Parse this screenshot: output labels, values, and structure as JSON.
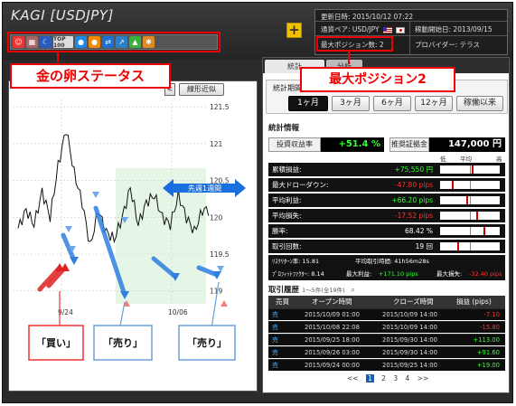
{
  "app": {
    "title": "KAGI [USDJPY]"
  },
  "status_icons": [
    "smile-egg-icon",
    "chart-egg-icon",
    "moon-egg-icon",
    "top100-badge",
    "blue-circle-egg-icon",
    "orange-ball-egg-icon",
    "arrows-egg-icon",
    "trend-egg-icon",
    "tree-egg-icon",
    "gear-egg-icon"
  ],
  "status_top_label": "TOP 100",
  "plus_label": "+",
  "info": {
    "updated_label": "更新日時:",
    "updated_value": "2015/10/12 07:22",
    "pair_label": "通貨ペア:",
    "pair_value": "USD/JPY",
    "start_label": "稼動開始日:",
    "start_value": "2013/09/15",
    "maxpos_label": "最大ポジション数:",
    "maxpos_value": "2",
    "provider_label": "プロバイダー:",
    "provider_value": "テラス"
  },
  "callouts": {
    "status": "金の卵ステータス",
    "maxpos": "最大ポジション2",
    "buy": "「買い」",
    "sell1": "「売り」",
    "sell2": "「売り」"
  },
  "chart": {
    "fit_button": "線形近似",
    "nav_prev": "<",
    "prev_week_label": "先週1週間",
    "y_ticks": [
      "121.5",
      "121",
      "120.5",
      "120",
      "119.5",
      "119"
    ],
    "x_ticks": [
      "9/24",
      "10/06"
    ]
  },
  "chart_data": {
    "type": "line",
    "x": [
      "9/24",
      "10/06"
    ],
    "ylim": [
      118.8,
      121.6
    ],
    "title": "",
    "xlabel": "",
    "ylabel": "",
    "series": [
      {
        "values": [
          119.85,
          120.1,
          119.9,
          120.35,
          120.0,
          120.7,
          121.2,
          120.6,
          120.2,
          119.6,
          120.1,
          119.8,
          119.7,
          120.0,
          120.4,
          119.9,
          120.2,
          120.3,
          120.0,
          119.9,
          120.3,
          120.0,
          119.8,
          120.1
        ]
      }
    ]
  },
  "tabs": [
    "統計",
    "分析"
  ],
  "period": {
    "label": "統計期間",
    "buttons": [
      "1ヶ月",
      "3ヶ月",
      "6ヶ月",
      "12ヶ月",
      "稼働以来"
    ],
    "active": 0
  },
  "stats": {
    "section_title": "統計情報",
    "kpi_return_label": "投資収益率",
    "kpi_return_value": "+51.4 %",
    "kpi_capital_label": "推奨証拠金",
    "kpi_capital_value": "147,000 円",
    "scale_low": "低",
    "scale_mid": "平均",
    "scale_high": "高",
    "rows": [
      {
        "label": "累積損益:",
        "value": "+75,550 円",
        "sign": "pos",
        "level": 0.55
      },
      {
        "label": "最大ドローダウン:",
        "value": "-47.80 pips",
        "sign": "neg",
        "level": 0.2
      },
      {
        "label": "平均利益:",
        "value": "+66.20 pips",
        "sign": "pos",
        "level": 0.45
      },
      {
        "label": "平均損失:",
        "value": "-17.52 pips",
        "sign": "neg",
        "level": 0.62
      },
      {
        "label": "勝率:",
        "value": "68.42 %",
        "sign": "plain",
        "level": 0.75
      },
      {
        "label": "取引回数:",
        "value": "19 回",
        "sign": "plain",
        "level": 0.3
      }
    ],
    "risk_label": "ﾘｽｸﾘﾀｰﾝ率: 15.81",
    "avg_hold_label": "平均取引時間: 41h56m28s",
    "pf_label": "ﾌﾟﾛﾌｨｯﾄﾌｧｸﾀｰ: 8.14",
    "max_profit_label": "最大利益:",
    "max_profit_value": "+171.10 pips",
    "max_loss_label": "最大損失:",
    "max_loss_value": "-32.40 pips"
  },
  "history": {
    "title": "取引履歴",
    "subtitle": "1〜5件(全19件)",
    "headers": [
      "売買",
      "オープン時間",
      "クローズ時間",
      "損益 (pips)"
    ],
    "rows": [
      {
        "side": "売",
        "open": "2015/10/09 01:00",
        "close": "2015/10/09 14:00",
        "pnl": "-7.10",
        "sign": "neg"
      },
      {
        "side": "売",
        "open": "2015/10/08 22:08",
        "close": "2015/10/09 14:00",
        "pnl": "-15.80",
        "sign": "neg"
      },
      {
        "side": "売",
        "open": "2015/09/25 18:00",
        "close": "2015/09/30 14:00",
        "pnl": "+113.00",
        "sign": "pos"
      },
      {
        "side": "売",
        "open": "2015/09/26 03:00",
        "close": "2015/09/30 14:00",
        "pnl": "+91.60",
        "sign": "pos"
      },
      {
        "side": "売",
        "open": "2015/09/24 00:00",
        "close": "2015/09/25 14:00",
        "pnl": "+19.00",
        "sign": "pos"
      }
    ],
    "pager": [
      "<<",
      "1",
      "2",
      "3",
      "4",
      ">>"
    ],
    "pager_current": 1
  },
  "colors": {
    "accent_red": "#ee0000",
    "gain_green": "#33ff33",
    "loss_red": "#ff3333",
    "sell_blue": "#2f7fe0",
    "buy_red": "#e02020",
    "active_tab": "#1a5fb4"
  }
}
